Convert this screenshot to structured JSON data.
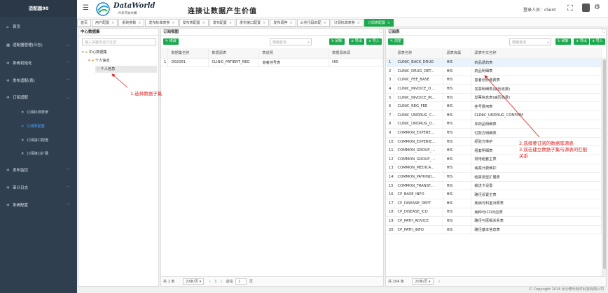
{
  "app": {
    "title": "适配器98"
  },
  "brand": {
    "name": "DataWorld",
    "slogan": "共享开放共赢",
    "tagline": "连接让数据产生价值"
  },
  "header": {
    "login_label": "登录人员：client"
  },
  "sidebar": {
    "items": [
      {
        "label": "首页",
        "icon": "home-icon"
      },
      {
        "label": "适配器管理(日志)",
        "icon": "grid-icon"
      },
      {
        "label": "系统初始化",
        "icon": "gear-icon"
      },
      {
        "label": "发布适配(表)",
        "icon": "gear-icon"
      },
      {
        "label": "订阅适配",
        "icon": "gear-icon"
      },
      {
        "label": "发布监控",
        "icon": "gear-icon"
      },
      {
        "label": "审计日志",
        "icon": "gear-icon"
      },
      {
        "label": "系统配置",
        "icon": "gear-icon"
      }
    ],
    "subitems": [
      "订阅标准表参",
      "订阅表配置",
      "订阅接口配置",
      "订阅接口扩展"
    ],
    "active_subitem": 1
  },
  "tabs": [
    {
      "label": "首页",
      "closable": false
    },
    {
      "label": "用户配置",
      "closable": true
    },
    {
      "label": "系统参数",
      "closable": true
    },
    {
      "label": "发布标准表参",
      "closable": true
    },
    {
      "label": "发布表配置",
      "closable": true
    },
    {
      "label": "发布配置",
      "closable": true
    },
    {
      "label": "发布接口配置",
      "closable": true
    },
    {
      "label": "发布调停",
      "closable": true
    },
    {
      "label": "公共代码匹配",
      "closable": true
    },
    {
      "label": "订阅标准表参",
      "closable": true
    },
    {
      "label": "订阅表配置",
      "closable": true,
      "active": true
    }
  ],
  "left_panel": {
    "title": "中心数据集",
    "search_placeholder": "输入关键字进行过滤",
    "tree": {
      "root": "中心数据集",
      "child": "个人信息",
      "leaf": "个人信息"
    }
  },
  "mid_panel": {
    "title": "订阅视图",
    "edit_label": "修改",
    "search_placeholder": "模糊查询",
    "refresh_label": "刷新",
    "import_label": "导入",
    "export_label": "导出",
    "columns": [
      "",
      "数据集名称",
      "数据源表",
      "表说明",
      "数据源来源"
    ],
    "rows": [
      [
        "1",
        "D02001",
        "CLINIC_PATIENT_REG",
        "患者挂号表",
        "HIS"
      ]
    ],
    "pager": {
      "total": "共 1 条",
      "page_size": "20条/页",
      "goto": "前往",
      "page": "1",
      "page_suffix": "页"
    }
  },
  "right_panel": {
    "title": "订阅表",
    "browse_label": "浏览",
    "search_placeholder": "模糊查询",
    "refresh_label": "刷新",
    "import_label": "导入",
    "export_label": "导出",
    "columns": [
      "",
      "源表名称",
      "源表库属",
      "源表中文名称"
    ],
    "rows": [
      [
        "1",
        "CLINIC_BACK_DRUG",
        "HIS",
        "药品退药表"
      ],
      [
        "2",
        "CLINIC_DRUG_DET...",
        "HIS",
        "药品明细表"
      ],
      [
        "3",
        "CLINIC_FEE_BASE",
        "HIS",
        "患者划价缴费表"
      ],
      [
        "4",
        "CLINIC_INVOICE_D...",
        "HIS",
        "发票明细表(病历收费)"
      ],
      [
        "5",
        "CLINIC_INVOICE_IN...",
        "HIS",
        "发票信息表(病历收费)"
      ],
      [
        "6",
        "CLINIC_REG_FEE",
        "HIS",
        "挂号费用表"
      ],
      [
        "7",
        "CLINIC_UNDRUG_C...",
        "HIS",
        "CLINIC_UNDRUG_CONFIRM"
      ],
      [
        "8",
        "CLINIC_UNDRUG_D...",
        "HIS",
        "非药品明细表"
      ],
      [
        "9",
        "COMMON_EXPERE...",
        "HIS",
        "付款方明细表"
      ],
      [
        "10",
        "COMMON_EXPERIE...",
        "HIS",
        "经验方维护"
      ],
      [
        "11",
        "COMMON_GROUP_...",
        "HIS",
        "组套明细表"
      ],
      [
        "12",
        "COMMON_GROUP_...",
        "HIS",
        "常用组套主表"
      ],
      [
        "13",
        "COMMON_MEDICA...",
        "HIS",
        "病案计费维护"
      ],
      [
        "14",
        "COMMON_PAYKIND...",
        "HIS",
        "结算类型扩展表"
      ],
      [
        "15",
        "COMMON_TRANSF...",
        "HIS",
        "输送卡设置"
      ],
      [
        "16",
        "CP_BASE_INFO",
        "HIS",
        "路径设置主表"
      ],
      [
        "17",
        "CP_DISEASE_DEPT",
        "HIS",
        "疾病与科室对照表"
      ],
      [
        "18",
        "CP_DISEASE_ICD",
        "HIS",
        "病种与ICD对应表"
      ],
      [
        "19",
        "CP_PATH_ADVICE",
        "HIS",
        "路径与医嘱关系表"
      ],
      [
        "20",
        "CP_PATH_INFO",
        "HIS",
        "路径基本信息表"
      ]
    ],
    "pager": {
      "total": "共 204 条",
      "page_size": "20条/页"
    }
  },
  "annotations": {
    "a1": "1.选择数据子集",
    "a2": [
      "2.选择要订阅的数据库源表",
      "3.双击建立数据子集与源表的匹配",
      "关系"
    ]
  },
  "footer": {
    "copyright": "© Copyright 2016 长沙攀乐软件科技有限公司"
  },
  "colors": {
    "sidebar_bg": "#2f3f4f",
    "accent_green": "#1aa94c",
    "annotation_red": "#e02020",
    "active_link": "#4aa3ff"
  }
}
